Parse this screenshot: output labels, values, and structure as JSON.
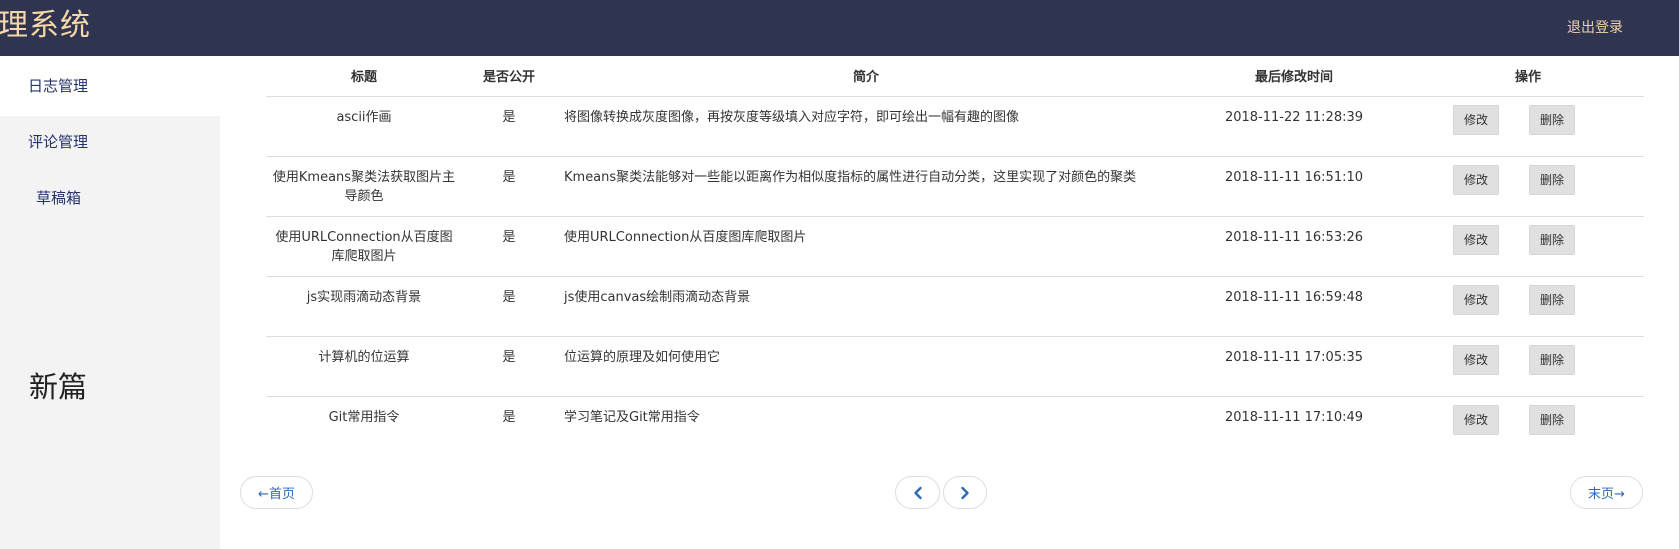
{
  "header": {
    "brand": "理系统",
    "logout_label": "退出登录"
  },
  "sidebar": {
    "items": [
      {
        "label": "日志管理",
        "active": true
      },
      {
        "label": "评论管理",
        "active": false
      },
      {
        "label": "草稿箱",
        "active": false
      }
    ],
    "new_post_label": "新篇"
  },
  "table": {
    "headers": {
      "title": "标题",
      "public": "是否公开",
      "summary": "简介",
      "modified": "最后修改时间",
      "ops": "操作"
    },
    "rows": [
      {
        "title": "ascii作画",
        "public": "是",
        "summary": "将图像转换成灰度图像，再按灰度等级填入对应字符，即可绘出一幅有趣的图像",
        "modified": "2018-11-22 11:28:39",
        "edit_label": "修改",
        "delete_label": "删除"
      },
      {
        "title": "使用Kmeans聚类法获取图片主导颜色",
        "public": "是",
        "summary": "Kmeans聚类法能够对一些能以距离作为相似度指标的属性进行自动分类，这里实现了对颜色的聚类",
        "modified": "2018-11-11 16:51:10",
        "edit_label": "修改",
        "delete_label": "删除"
      },
      {
        "title": "使用URLConnection从百度图库爬取图片",
        "public": "是",
        "summary": "使用URLConnection从百度图库爬取图片",
        "modified": "2018-11-11 16:53:26",
        "edit_label": "修改",
        "delete_label": "删除"
      },
      {
        "title": "js实现雨滴动态背景",
        "public": "是",
        "summary": "js使用canvas绘制雨滴动态背景",
        "modified": "2018-11-11 16:59:48",
        "edit_label": "修改",
        "delete_label": "删除"
      },
      {
        "title": "计算机的位运算",
        "public": "是",
        "summary": "位运算的原理及如何使用它",
        "modified": "2018-11-11 17:05:35",
        "edit_label": "修改",
        "delete_label": "删除"
      },
      {
        "title": "Git常用指令",
        "public": "是",
        "summary": "学习笔记及Git常用指令",
        "modified": "2018-11-11 17:10:49",
        "edit_label": "修改",
        "delete_label": "删除"
      }
    ]
  },
  "pagination": {
    "first_label": "←首页",
    "last_label": "末页→",
    "prev_icon": "chevron-left-icon",
    "next_icon": "chevron-right-icon"
  },
  "colors": {
    "header_bg": "#2f3550",
    "brand_text": "#f5d7a8",
    "sidebar_bg": "#f3f3f3",
    "sidebar_link": "#24336d",
    "pager_link": "#2a6ab7",
    "button_bg": "#e0e0e0"
  }
}
